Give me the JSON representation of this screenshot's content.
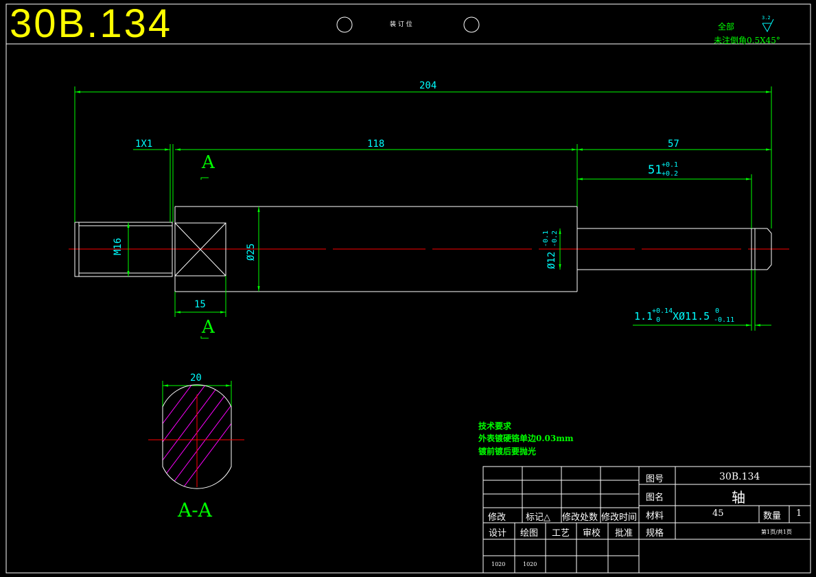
{
  "header": {
    "drawing_number": "30B.134",
    "binding_label": "装 订 位"
  },
  "notes": {
    "all_label": "全部",
    "roughness": "3.2",
    "chamfer_note": "未注倒角0.5X45°"
  },
  "dimensions": {
    "overall_length": "204",
    "thread_chamfer": "1X1",
    "body_length": "118",
    "right_length": "57",
    "groove_position": "51",
    "groove_position_tol_upper": "+0.1",
    "groove_position_tol_lower": "+0.2",
    "thread": "M16",
    "body_diameter": "Ø25",
    "shaft_diameter": "Ø12",
    "shaft_tol_upper": "-0.1",
    "shaft_tol_lower": "-0.2",
    "flat_length": "15",
    "groove_spec": "1.1",
    "groove_tol_upper": "+0.14",
    "groove_tol_lower": "0",
    "groove_diameter": "XØ11.5",
    "groove_dia_tol_upper": "0",
    "groove_dia_tol_lower": "-0.11",
    "flat_width": "20"
  },
  "section": {
    "marker": "A",
    "view_label": "A-A"
  },
  "technical_requirements": {
    "title": "技术要求",
    "line1": "外表镀硬铬单边0.03mm",
    "line2": "镀前镀后要抛光"
  },
  "title_block": {
    "revision_labels": [
      "修改",
      "标记△",
      "修改处数",
      "修改时间"
    ],
    "sign_labels": [
      "设计",
      "绘图",
      "工艺",
      "审校",
      "批准"
    ],
    "design_code": "1020",
    "drawing_code": "1020",
    "drawing_no_label": "图号",
    "drawing_no_value": "30B.134",
    "name_label": "图名",
    "name_value": "轴",
    "material_label": "材料",
    "material_value": "45",
    "quantity_label": "数量",
    "quantity_value": "1",
    "spec_label": "规格",
    "page_info": "第1页/共1页"
  },
  "colors": {
    "background": "#000000",
    "outline": "#ffffff",
    "dimension": "#00ff00",
    "dimension_text": "#00ffff",
    "centerline": "#ff0000",
    "hatch": "#ff00ff",
    "title": "#ffff00"
  }
}
